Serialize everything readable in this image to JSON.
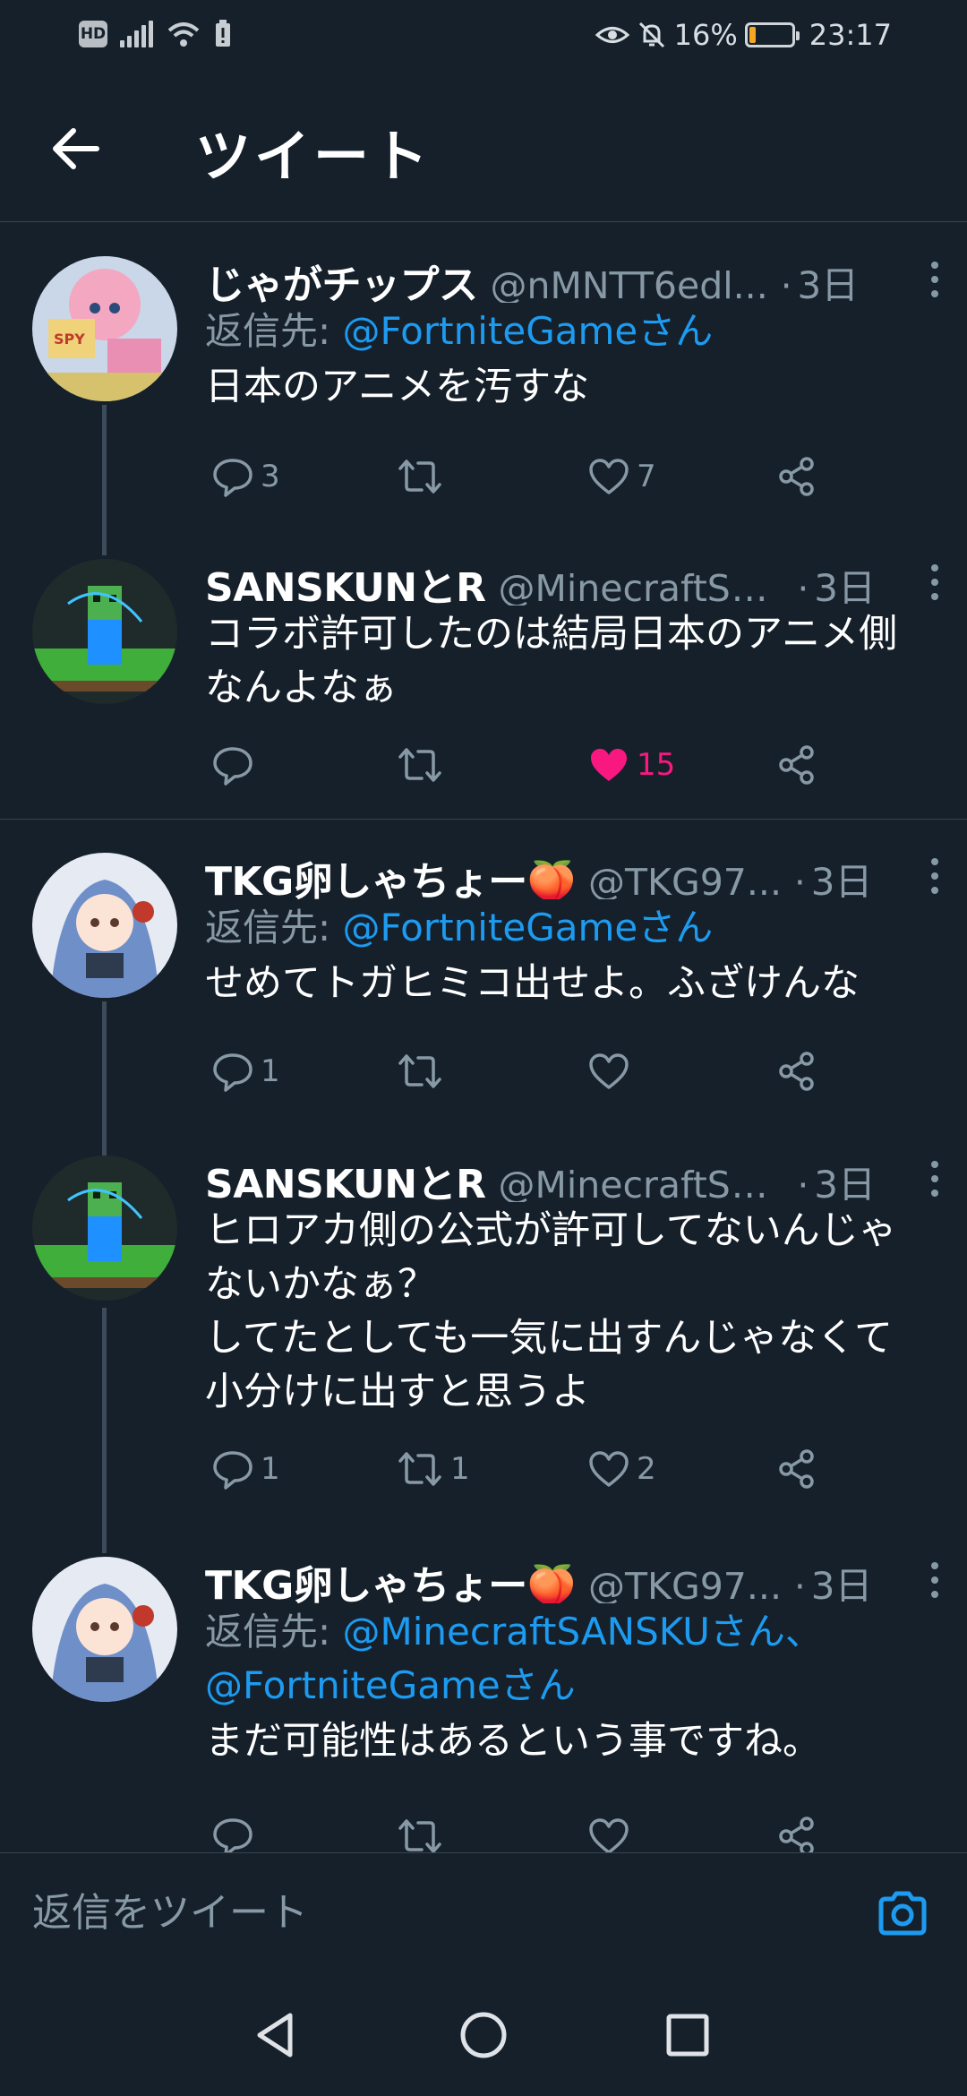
{
  "status_bar": {
    "hd_label": "HD",
    "battery_percent": "16%",
    "battery_level": 0.16,
    "time": "23:17"
  },
  "header": {
    "title": "ツイート"
  },
  "colors": {
    "background": "#15202b",
    "accent": "#1d9bf0",
    "like": "#f91880",
    "muted": "#8899a6",
    "divider": "#38444d"
  },
  "tweets": [
    {
      "name": "じゃがチップス",
      "handle": "@nMNTT6edl...",
      "dot": "·",
      "time": "3日",
      "reply_prefix": "返信先: ",
      "reply_mentions": "@FortniteGameさん",
      "text": "日本のアニメを汚すな",
      "reply_count": "3",
      "retweet_count": "",
      "like_count": "7",
      "liked": false
    },
    {
      "name": "SANSKUNとR",
      "handle": "@MinecraftSA...",
      "dot": "·",
      "time": "3日",
      "text": "コラボ許可したのは結局日本のアニメ側\nなんよなぁ",
      "reply_count": "",
      "retweet_count": "",
      "like_count": "15",
      "liked": true
    },
    {
      "name": "TKG卵しゃちょー🍑",
      "handle": "@TKG97...",
      "dot": "·",
      "time": "3日",
      "reply_prefix": "返信先: ",
      "reply_mentions": "@FortniteGameさん",
      "text": "せめてトガヒミコ出せよ。ふざけんな",
      "reply_count": "1",
      "retweet_count": "",
      "like_count": "",
      "liked": false
    },
    {
      "name": "SANSKUNとR",
      "handle": "@MinecraftSA...",
      "dot": "·",
      "time": "3日",
      "text": "ヒロアカ側の公式が許可してないんじゃ\nないかなぁ？\nしてたとしても一気に出すんじゃなくて\n小分けに出すと思うよ",
      "reply_count": "1",
      "retweet_count": "1",
      "like_count": "2",
      "liked": false
    },
    {
      "name": "TKG卵しゃちょー🍑",
      "handle": "@TKG97...",
      "dot": "·",
      "time": "3日",
      "reply_prefix": "返信先: ",
      "reply_mentions": "@MinecraftSANSKUさん、\n@FortniteGameさん",
      "text": "まだ可能性はあるという事ですね。",
      "reply_count": "",
      "retweet_count": "",
      "like_count": "",
      "liked": false
    }
  ],
  "composer": {
    "placeholder": "返信をツイート",
    "camera_icon": "camera-icon"
  },
  "nav": {
    "back_icon": "triangle-back-icon",
    "home_icon": "circle-home-icon",
    "recents_icon": "square-recents-icon"
  }
}
